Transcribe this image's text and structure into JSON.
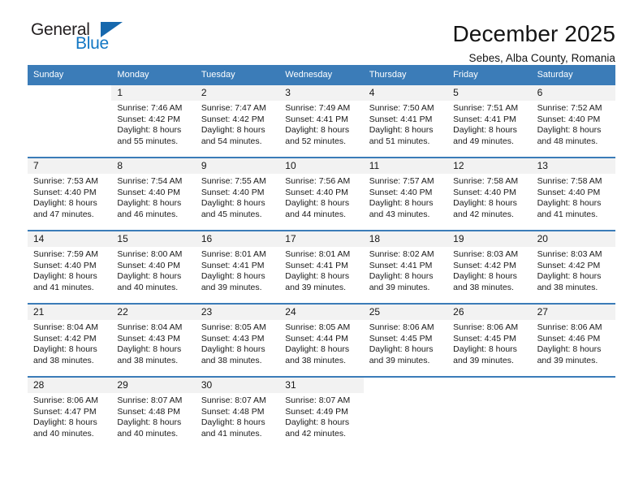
{
  "brand": {
    "name_part1": "General",
    "name_part2": "Blue",
    "triangle_color": "#1668ad",
    "blue_color": "#1277c4"
  },
  "header": {
    "title": "December 2025",
    "subtitle": "Sebes, Alba County, Romania"
  },
  "calendar": {
    "header_bg": "#3b7cb8",
    "daynum_bg": "#f2f2f2",
    "weekdays": [
      "Sunday",
      "Monday",
      "Tuesday",
      "Wednesday",
      "Thursday",
      "Friday",
      "Saturday"
    ],
    "weeks": [
      [
        {
          "day": "",
          "sunrise": "",
          "sunset": "",
          "daylight1": "",
          "daylight2": ""
        },
        {
          "day": "1",
          "sunrise": "Sunrise: 7:46 AM",
          "sunset": "Sunset: 4:42 PM",
          "daylight1": "Daylight: 8 hours",
          "daylight2": "and 55 minutes."
        },
        {
          "day": "2",
          "sunrise": "Sunrise: 7:47 AM",
          "sunset": "Sunset: 4:42 PM",
          "daylight1": "Daylight: 8 hours",
          "daylight2": "and 54 minutes."
        },
        {
          "day": "3",
          "sunrise": "Sunrise: 7:49 AM",
          "sunset": "Sunset: 4:41 PM",
          "daylight1": "Daylight: 8 hours",
          "daylight2": "and 52 minutes."
        },
        {
          "day": "4",
          "sunrise": "Sunrise: 7:50 AM",
          "sunset": "Sunset: 4:41 PM",
          "daylight1": "Daylight: 8 hours",
          "daylight2": "and 51 minutes."
        },
        {
          "day": "5",
          "sunrise": "Sunrise: 7:51 AM",
          "sunset": "Sunset: 4:41 PM",
          "daylight1": "Daylight: 8 hours",
          "daylight2": "and 49 minutes."
        },
        {
          "day": "6",
          "sunrise": "Sunrise: 7:52 AM",
          "sunset": "Sunset: 4:40 PM",
          "daylight1": "Daylight: 8 hours",
          "daylight2": "and 48 minutes."
        }
      ],
      [
        {
          "day": "7",
          "sunrise": "Sunrise: 7:53 AM",
          "sunset": "Sunset: 4:40 PM",
          "daylight1": "Daylight: 8 hours",
          "daylight2": "and 47 minutes."
        },
        {
          "day": "8",
          "sunrise": "Sunrise: 7:54 AM",
          "sunset": "Sunset: 4:40 PM",
          "daylight1": "Daylight: 8 hours",
          "daylight2": "and 46 minutes."
        },
        {
          "day": "9",
          "sunrise": "Sunrise: 7:55 AM",
          "sunset": "Sunset: 4:40 PM",
          "daylight1": "Daylight: 8 hours",
          "daylight2": "and 45 minutes."
        },
        {
          "day": "10",
          "sunrise": "Sunrise: 7:56 AM",
          "sunset": "Sunset: 4:40 PM",
          "daylight1": "Daylight: 8 hours",
          "daylight2": "and 44 minutes."
        },
        {
          "day": "11",
          "sunrise": "Sunrise: 7:57 AM",
          "sunset": "Sunset: 4:40 PM",
          "daylight1": "Daylight: 8 hours",
          "daylight2": "and 43 minutes."
        },
        {
          "day": "12",
          "sunrise": "Sunrise: 7:58 AM",
          "sunset": "Sunset: 4:40 PM",
          "daylight1": "Daylight: 8 hours",
          "daylight2": "and 42 minutes."
        },
        {
          "day": "13",
          "sunrise": "Sunrise: 7:58 AM",
          "sunset": "Sunset: 4:40 PM",
          "daylight1": "Daylight: 8 hours",
          "daylight2": "and 41 minutes."
        }
      ],
      [
        {
          "day": "14",
          "sunrise": "Sunrise: 7:59 AM",
          "sunset": "Sunset: 4:40 PM",
          "daylight1": "Daylight: 8 hours",
          "daylight2": "and 41 minutes."
        },
        {
          "day": "15",
          "sunrise": "Sunrise: 8:00 AM",
          "sunset": "Sunset: 4:40 PM",
          "daylight1": "Daylight: 8 hours",
          "daylight2": "and 40 minutes."
        },
        {
          "day": "16",
          "sunrise": "Sunrise: 8:01 AM",
          "sunset": "Sunset: 4:41 PM",
          "daylight1": "Daylight: 8 hours",
          "daylight2": "and 39 minutes."
        },
        {
          "day": "17",
          "sunrise": "Sunrise: 8:01 AM",
          "sunset": "Sunset: 4:41 PM",
          "daylight1": "Daylight: 8 hours",
          "daylight2": "and 39 minutes."
        },
        {
          "day": "18",
          "sunrise": "Sunrise: 8:02 AM",
          "sunset": "Sunset: 4:41 PM",
          "daylight1": "Daylight: 8 hours",
          "daylight2": "and 39 minutes."
        },
        {
          "day": "19",
          "sunrise": "Sunrise: 8:03 AM",
          "sunset": "Sunset: 4:42 PM",
          "daylight1": "Daylight: 8 hours",
          "daylight2": "and 38 minutes."
        },
        {
          "day": "20",
          "sunrise": "Sunrise: 8:03 AM",
          "sunset": "Sunset: 4:42 PM",
          "daylight1": "Daylight: 8 hours",
          "daylight2": "and 38 minutes."
        }
      ],
      [
        {
          "day": "21",
          "sunrise": "Sunrise: 8:04 AM",
          "sunset": "Sunset: 4:42 PM",
          "daylight1": "Daylight: 8 hours",
          "daylight2": "and 38 minutes."
        },
        {
          "day": "22",
          "sunrise": "Sunrise: 8:04 AM",
          "sunset": "Sunset: 4:43 PM",
          "daylight1": "Daylight: 8 hours",
          "daylight2": "and 38 minutes."
        },
        {
          "day": "23",
          "sunrise": "Sunrise: 8:05 AM",
          "sunset": "Sunset: 4:43 PM",
          "daylight1": "Daylight: 8 hours",
          "daylight2": "and 38 minutes."
        },
        {
          "day": "24",
          "sunrise": "Sunrise: 8:05 AM",
          "sunset": "Sunset: 4:44 PM",
          "daylight1": "Daylight: 8 hours",
          "daylight2": "and 38 minutes."
        },
        {
          "day": "25",
          "sunrise": "Sunrise: 8:06 AM",
          "sunset": "Sunset: 4:45 PM",
          "daylight1": "Daylight: 8 hours",
          "daylight2": "and 39 minutes."
        },
        {
          "day": "26",
          "sunrise": "Sunrise: 8:06 AM",
          "sunset": "Sunset: 4:45 PM",
          "daylight1": "Daylight: 8 hours",
          "daylight2": "and 39 minutes."
        },
        {
          "day": "27",
          "sunrise": "Sunrise: 8:06 AM",
          "sunset": "Sunset: 4:46 PM",
          "daylight1": "Daylight: 8 hours",
          "daylight2": "and 39 minutes."
        }
      ],
      [
        {
          "day": "28",
          "sunrise": "Sunrise: 8:06 AM",
          "sunset": "Sunset: 4:47 PM",
          "daylight1": "Daylight: 8 hours",
          "daylight2": "and 40 minutes."
        },
        {
          "day": "29",
          "sunrise": "Sunrise: 8:07 AM",
          "sunset": "Sunset: 4:48 PM",
          "daylight1": "Daylight: 8 hours",
          "daylight2": "and 40 minutes."
        },
        {
          "day": "30",
          "sunrise": "Sunrise: 8:07 AM",
          "sunset": "Sunset: 4:48 PM",
          "daylight1": "Daylight: 8 hours",
          "daylight2": "and 41 minutes."
        },
        {
          "day": "31",
          "sunrise": "Sunrise: 8:07 AM",
          "sunset": "Sunset: 4:49 PM",
          "daylight1": "Daylight: 8 hours",
          "daylight2": "and 42 minutes."
        },
        {
          "day": "",
          "sunrise": "",
          "sunset": "",
          "daylight1": "",
          "daylight2": ""
        },
        {
          "day": "",
          "sunrise": "",
          "sunset": "",
          "daylight1": "",
          "daylight2": ""
        },
        {
          "day": "",
          "sunrise": "",
          "sunset": "",
          "daylight1": "",
          "daylight2": ""
        }
      ]
    ]
  }
}
